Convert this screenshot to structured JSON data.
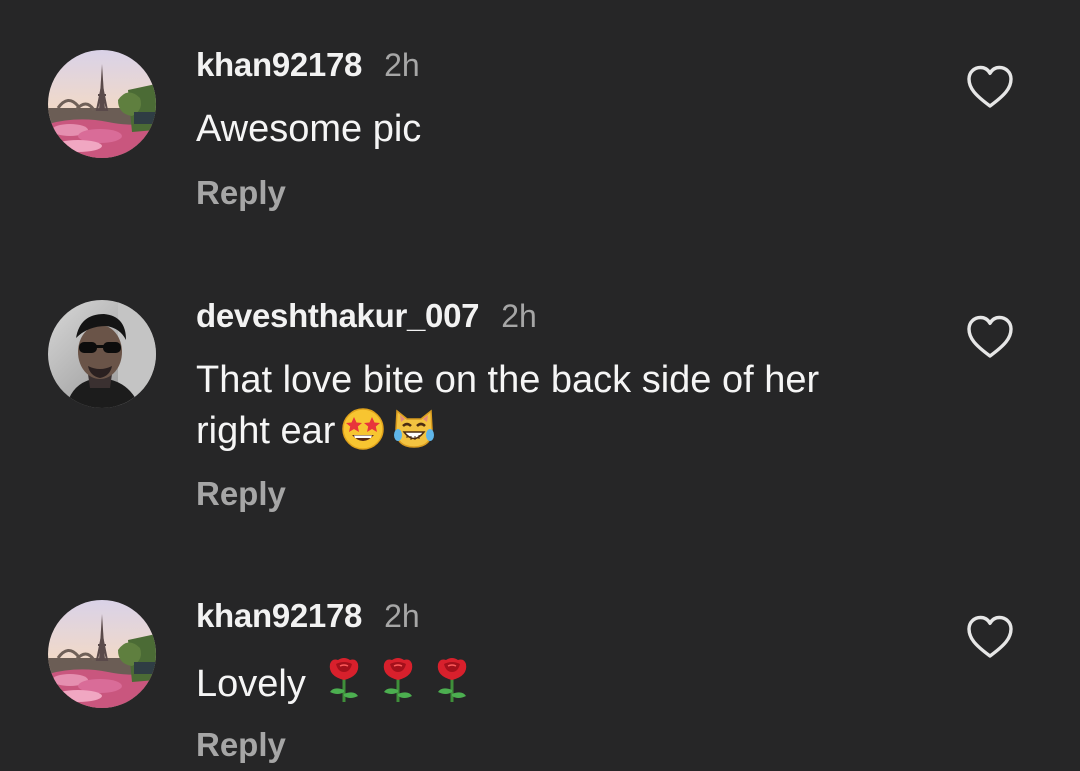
{
  "comments": [
    {
      "username": "khan92178",
      "time": "2h",
      "text": "Awesome pic",
      "emoji": [],
      "reply_label": "Reply",
      "avatar_icon": "eiffel-tower-photo-avatar"
    },
    {
      "username": "deveshthakur_007",
      "time": "2h",
      "text_line1": "That love bite on the back side of her",
      "text_line2": "right ear",
      "emoji": [
        "star-struck-emoji",
        "cat-with-tears-of-joy-emoji"
      ],
      "reply_label": "Reply",
      "avatar_icon": "man-sunglasses-photo-avatar"
    },
    {
      "username": "khan92178",
      "time": "2h",
      "text": "Lovely",
      "emoji": [
        "rose-emoji",
        "rose-emoji",
        "rose-emoji"
      ],
      "reply_label": "Reply",
      "avatar_icon": "eiffel-tower-photo-avatar"
    }
  ],
  "colors": {
    "background": "#262627",
    "primary_text": "#f5f5f5",
    "secondary_text": "#a6a6a6",
    "heart_outline": "#e6e6e6"
  },
  "icons": {
    "like": "heart-outline-icon"
  }
}
